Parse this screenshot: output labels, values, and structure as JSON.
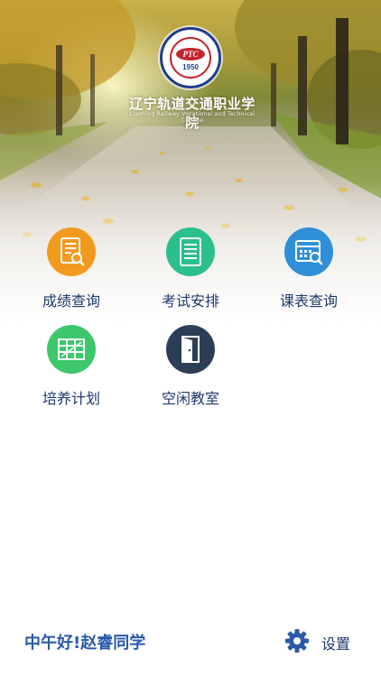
{
  "header": {
    "school_name": "辽宁轨道交通职业学院",
    "school_name_en": "Liaoning Railway Vocational and Technical College",
    "logo_text": "PTC",
    "logo_year": "1950"
  },
  "menu": {
    "items": [
      {
        "label": "成绩查询",
        "icon": "report-card-icon",
        "color": "#f29a1f"
      },
      {
        "label": "考试安排",
        "icon": "document-icon",
        "color": "#2bbf8e"
      },
      {
        "label": "课表查询",
        "icon": "schedule-search-icon",
        "color": "#2f8fd8"
      },
      {
        "label": "培养计划",
        "icon": "plan-grid-icon",
        "color": "#3cc76a"
      },
      {
        "label": "空闲教室",
        "icon": "door-icon",
        "color": "#2c3e55"
      }
    ]
  },
  "footer": {
    "greeting": "中午好!赵睿同学",
    "settings_label": "设置",
    "settings_icon": "gear-icon",
    "accent_color": "#2a5aa8"
  }
}
